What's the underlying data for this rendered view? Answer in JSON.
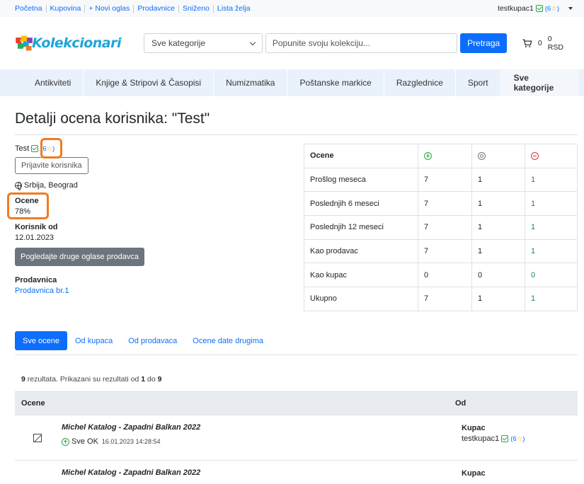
{
  "topbar": {
    "links": [
      "Početna",
      "Kupovina",
      "+ Novi oglas",
      "Prodavnice",
      "Sniženo",
      "Lista želja"
    ],
    "username": "testkupac1",
    "rating_open": "(6",
    "rating_close": ")"
  },
  "header": {
    "logo_text": "Kolekcionari",
    "category_select": "Sve kategorije",
    "search_placeholder": "Popunite svoju kolekciju...",
    "search_button": "Pretraga",
    "cart_count": "0",
    "cart_total": "0 RSD"
  },
  "categories": [
    "Antikviteti",
    "Knjige & Stripovi & Časopisi",
    "Numizmatika",
    "Poštanske markice",
    "Razglednice",
    "Sport",
    "Sve kategorije"
  ],
  "page": {
    "title": "Detalji ocena korisnika: \"Test\""
  },
  "profile": {
    "name": "Test",
    "rating_open": "(6",
    "rating_close": ")",
    "report_button": "Prijavite korisnika",
    "location": "Srbija, Beograd",
    "ratings_label": "Ocene",
    "ratings_value": "78%",
    "member_since_label": "Korisnik od",
    "member_since_value": "12.01.2023",
    "other_ads_button": "Pogledajte druge oglase prodavca",
    "shop_label": "Prodavnica",
    "shop_link": "Prodavnica br.1"
  },
  "stats": {
    "header": "Ocene",
    "rows": [
      {
        "label": "Prošlog meseca",
        "pos": "7",
        "neu": "1",
        "neg": "1"
      },
      {
        "label": "Poslednjih 6 meseci",
        "pos": "7",
        "neu": "1",
        "neg": "1"
      },
      {
        "label": "Poslednjih 12 meseci",
        "pos": "7",
        "neu": "1",
        "neg": "1"
      },
      {
        "label": "Kao prodavac",
        "pos": "7",
        "neu": "1",
        "neg": "1"
      },
      {
        "label": "Kao kupac",
        "pos": "0",
        "neu": "0",
        "neg": "0"
      },
      {
        "label": "Ukupno",
        "pos": "7",
        "neu": "1",
        "neg": "1"
      }
    ]
  },
  "tabs": [
    "Sve ocene",
    "Od kupaca",
    "Od prodavaca",
    "Ocene date drugima"
  ],
  "results": {
    "count": "9",
    "text_a": " rezultata. Prikazani su rezultati od ",
    "from": "1",
    "text_b": " do ",
    "to": "9"
  },
  "reviews_table": {
    "col_ratings": "Ocene",
    "col_from": "Od",
    "rows": [
      {
        "title": "Michel Katalog - Zapadni Balkan 2022",
        "status": "Sve OK",
        "timestamp": "16.01.2023 14:28:54",
        "role": "Kupac",
        "user": "testkupac1",
        "rating_open": "(6",
        "rating_close": ")"
      },
      {
        "title": "Michel Katalog - Zapadni Balkan 2022",
        "status": "",
        "timestamp": "",
        "role": "Kupac",
        "user": "",
        "rating_open": "",
        "rating_close": ""
      }
    ]
  }
}
